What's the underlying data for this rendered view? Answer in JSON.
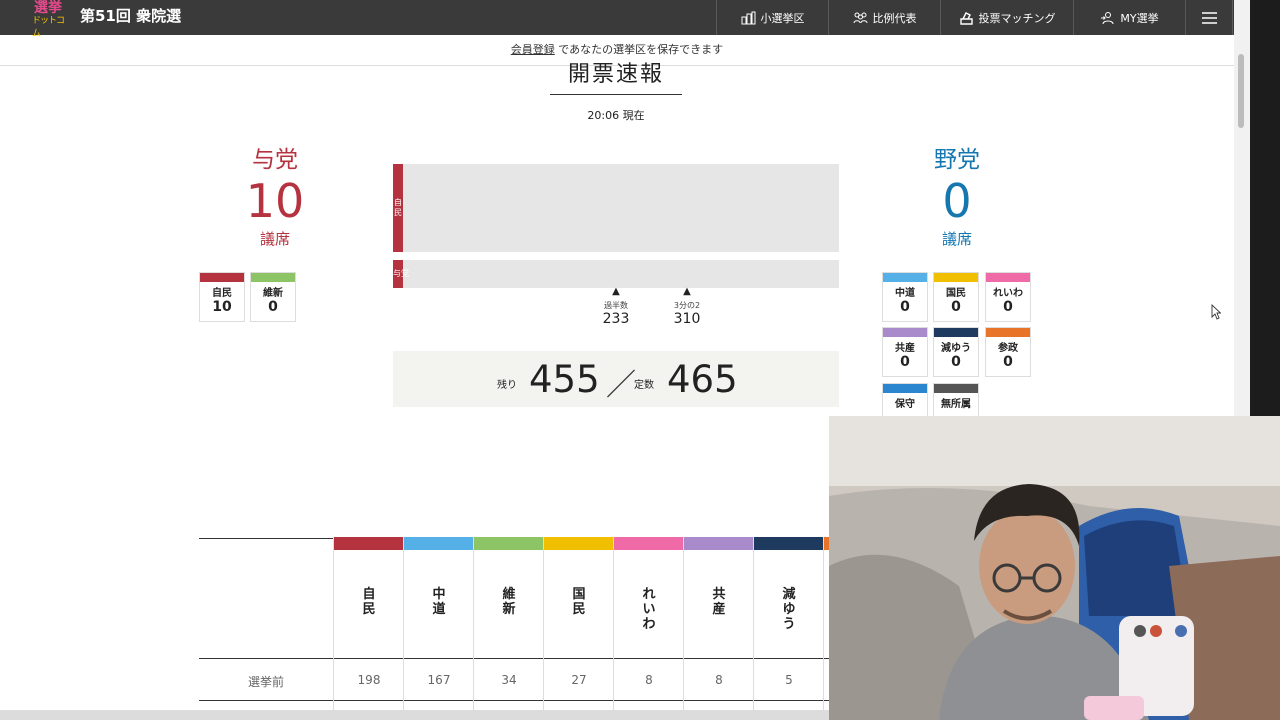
{
  "header": {
    "site_title": "第51回 衆院選",
    "logo_line1": "選挙",
    "logo_line2": "ドットコム",
    "nav": [
      {
        "label": "小選挙区",
        "icon": "district-icon"
      },
      {
        "label": "比例代表",
        "icon": "people-icon"
      },
      {
        "label": "投票マッチング",
        "icon": "ballot-box-icon"
      },
      {
        "label": "MY選挙",
        "icon": "person-arrow-icon"
      },
      {
        "label": "",
        "icon": "hamburger-menu-icon"
      }
    ]
  },
  "notice": {
    "link": "会員登録",
    "text": " であなたの選挙区を保存できます"
  },
  "results": {
    "title": "開票速報",
    "time": "20:06 現在",
    "ruling": {
      "label": "与党",
      "seats": "10",
      "unit": "議席"
    },
    "opposition": {
      "label": "野党",
      "seats": "0",
      "unit": "議席"
    },
    "bar_top_label": "自民",
    "bar_bottom_label": "与党",
    "bar_top_fraction": 0.022,
    "bar_bottom_fraction": 0.022,
    "majority": {
      "label": "過半数",
      "value": "233"
    },
    "two_thirds": {
      "label": "3分の2",
      "value": "310"
    },
    "remaining_label": "残り",
    "remaining": "455",
    "slash": "／",
    "total_label": "定数",
    "total": "465"
  },
  "ruling_parties": [
    {
      "name": "自民",
      "seats": "10",
      "color": "#b5323f"
    },
    {
      "name": "維新",
      "seats": "0",
      "color": "#8cc466"
    }
  ],
  "opposition_parties": [
    {
      "name": "中道",
      "seats": "0",
      "color": "#55b0e8"
    },
    {
      "name": "国民",
      "seats": "0",
      "color": "#f0c000"
    },
    {
      "name": "れいわ",
      "seats": "0",
      "color": "#f06aa8"
    },
    {
      "name": "共産",
      "seats": "0",
      "color": "#a98acb"
    },
    {
      "name": "減ゆう",
      "seats": "0",
      "color": "#1f3a5f"
    },
    {
      "name": "参政",
      "seats": "0",
      "color": "#e8742a"
    },
    {
      "name": "保守",
      "seats": "",
      "color": "#2b85cf"
    },
    {
      "name": "無所属",
      "seats": "",
      "color": "#555555"
    }
  ],
  "table": {
    "row_label": "選挙前",
    "columns": [
      {
        "name": "自民",
        "value": "198",
        "color": "#b5323f"
      },
      {
        "name": "中道",
        "value": "167",
        "color": "#55b0e8"
      },
      {
        "name": "維新",
        "value": "34",
        "color": "#8cc466"
      },
      {
        "name": "国民",
        "value": "27",
        "color": "#f0c000"
      },
      {
        "name": "れいわ",
        "value": "8",
        "color": "#f06aa8"
      },
      {
        "name": "共産",
        "value": "8",
        "color": "#a98acb"
      },
      {
        "name": "減ゆう",
        "value": "5",
        "color": "#1f3a5f"
      }
    ]
  }
}
